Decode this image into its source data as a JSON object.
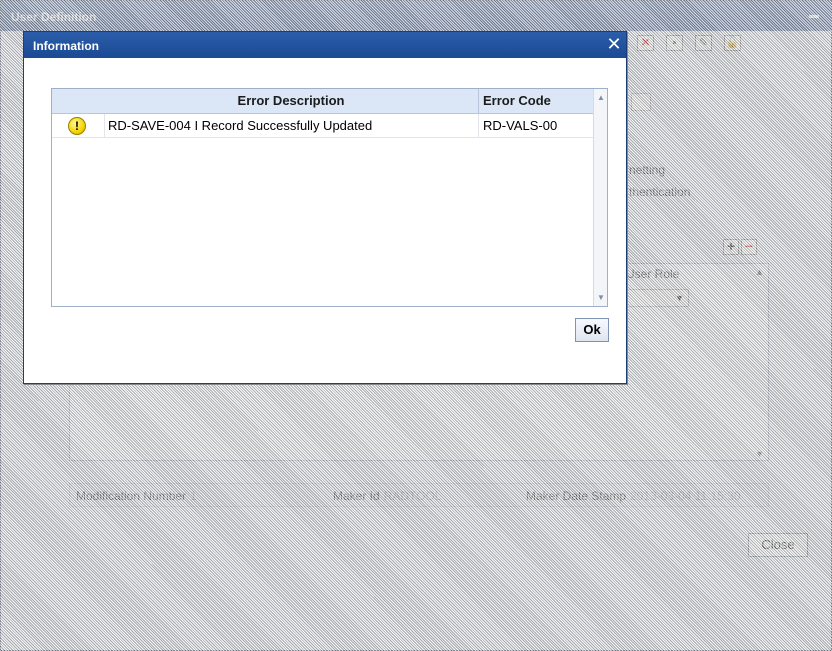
{
  "background_window": {
    "title": "User Definition",
    "fragments": {
      "netting": "netting",
      "authentication": "thentication",
      "user_role_header": "User Role"
    },
    "footer": {
      "modification_number_label": "Modification Number",
      "modification_number_value": "1",
      "maker_id_label": "Maker Id",
      "maker_id_value": "RADTOOL",
      "maker_date_stamp_label": "Maker Date Stamp",
      "maker_date_stamp_value": "2013-03-04 11:15:30"
    },
    "close_label": "Close"
  },
  "dialog": {
    "title": "Information",
    "close_glyph": "✕",
    "columns": {
      "description": "Error Description",
      "code": "Error Code"
    },
    "rows": [
      {
        "icon": "warning-icon",
        "icon_glyph": "!",
        "description": "RD-SAVE-004 I Record Successfully Updated",
        "code": "RD-VALS-00"
      }
    ],
    "ok_label": "Ok"
  }
}
